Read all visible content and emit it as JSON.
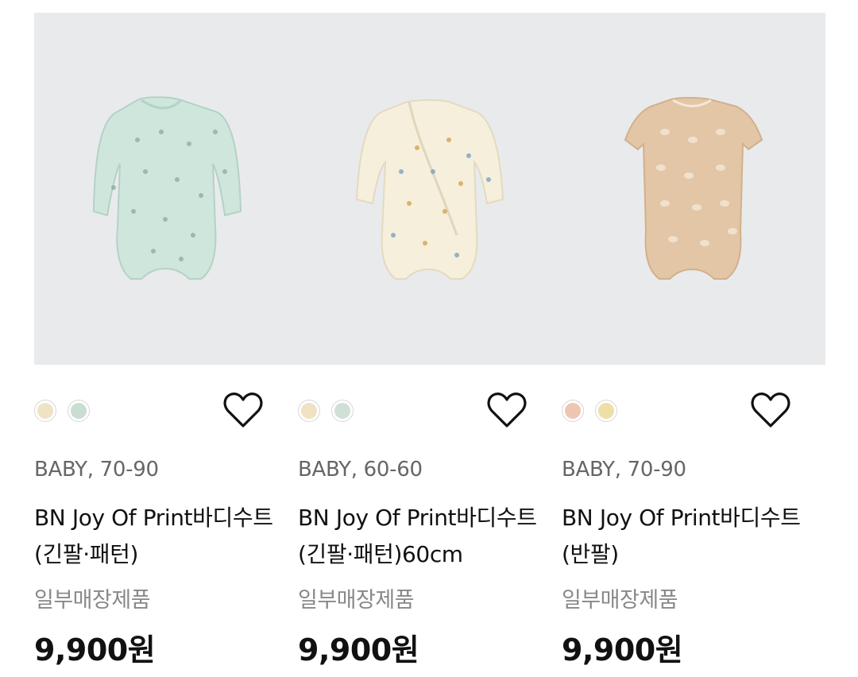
{
  "products": [
    {
      "category": "BABY, 70-90",
      "name": "BN Joy Of Print바디수트(긴팔·패턴)",
      "availability": "일부매장제품",
      "price": "9,900원",
      "image": "mint long-sleeve giraffe print bodysuit",
      "swatches": [
        "#efe3c6",
        "#c9ddd3"
      ],
      "wishlist_icon": "heart-outline-icon"
    },
    {
      "category": "BABY, 60-60",
      "name": "BN Joy Of Print바디수트(긴팔·패턴)60cm",
      "availability": "일부매장제품",
      "price": "9,900원",
      "image": "cream wrap long-sleeve animal print bodysuit",
      "swatches": [
        "#f0e2c2",
        "#cfe0d7"
      ],
      "wishlist_icon": "heart-outline-icon"
    },
    {
      "category": "BABY, 70-90",
      "name": "BN Joy Of Print바디수트(반팔)",
      "availability": "일부매장제품",
      "price": "9,900원",
      "image": "beige short-sleeve leaf print bodysuit",
      "swatches": [
        "#edc6b3",
        "#eedfa6"
      ],
      "wishlist_icon": "heart-outline-icon"
    }
  ],
  "colors": {
    "image_bg": "#e9eaec",
    "mint": "#cfe6dc",
    "cream": "#f5efdc",
    "beige": "#e2c6a6"
  }
}
